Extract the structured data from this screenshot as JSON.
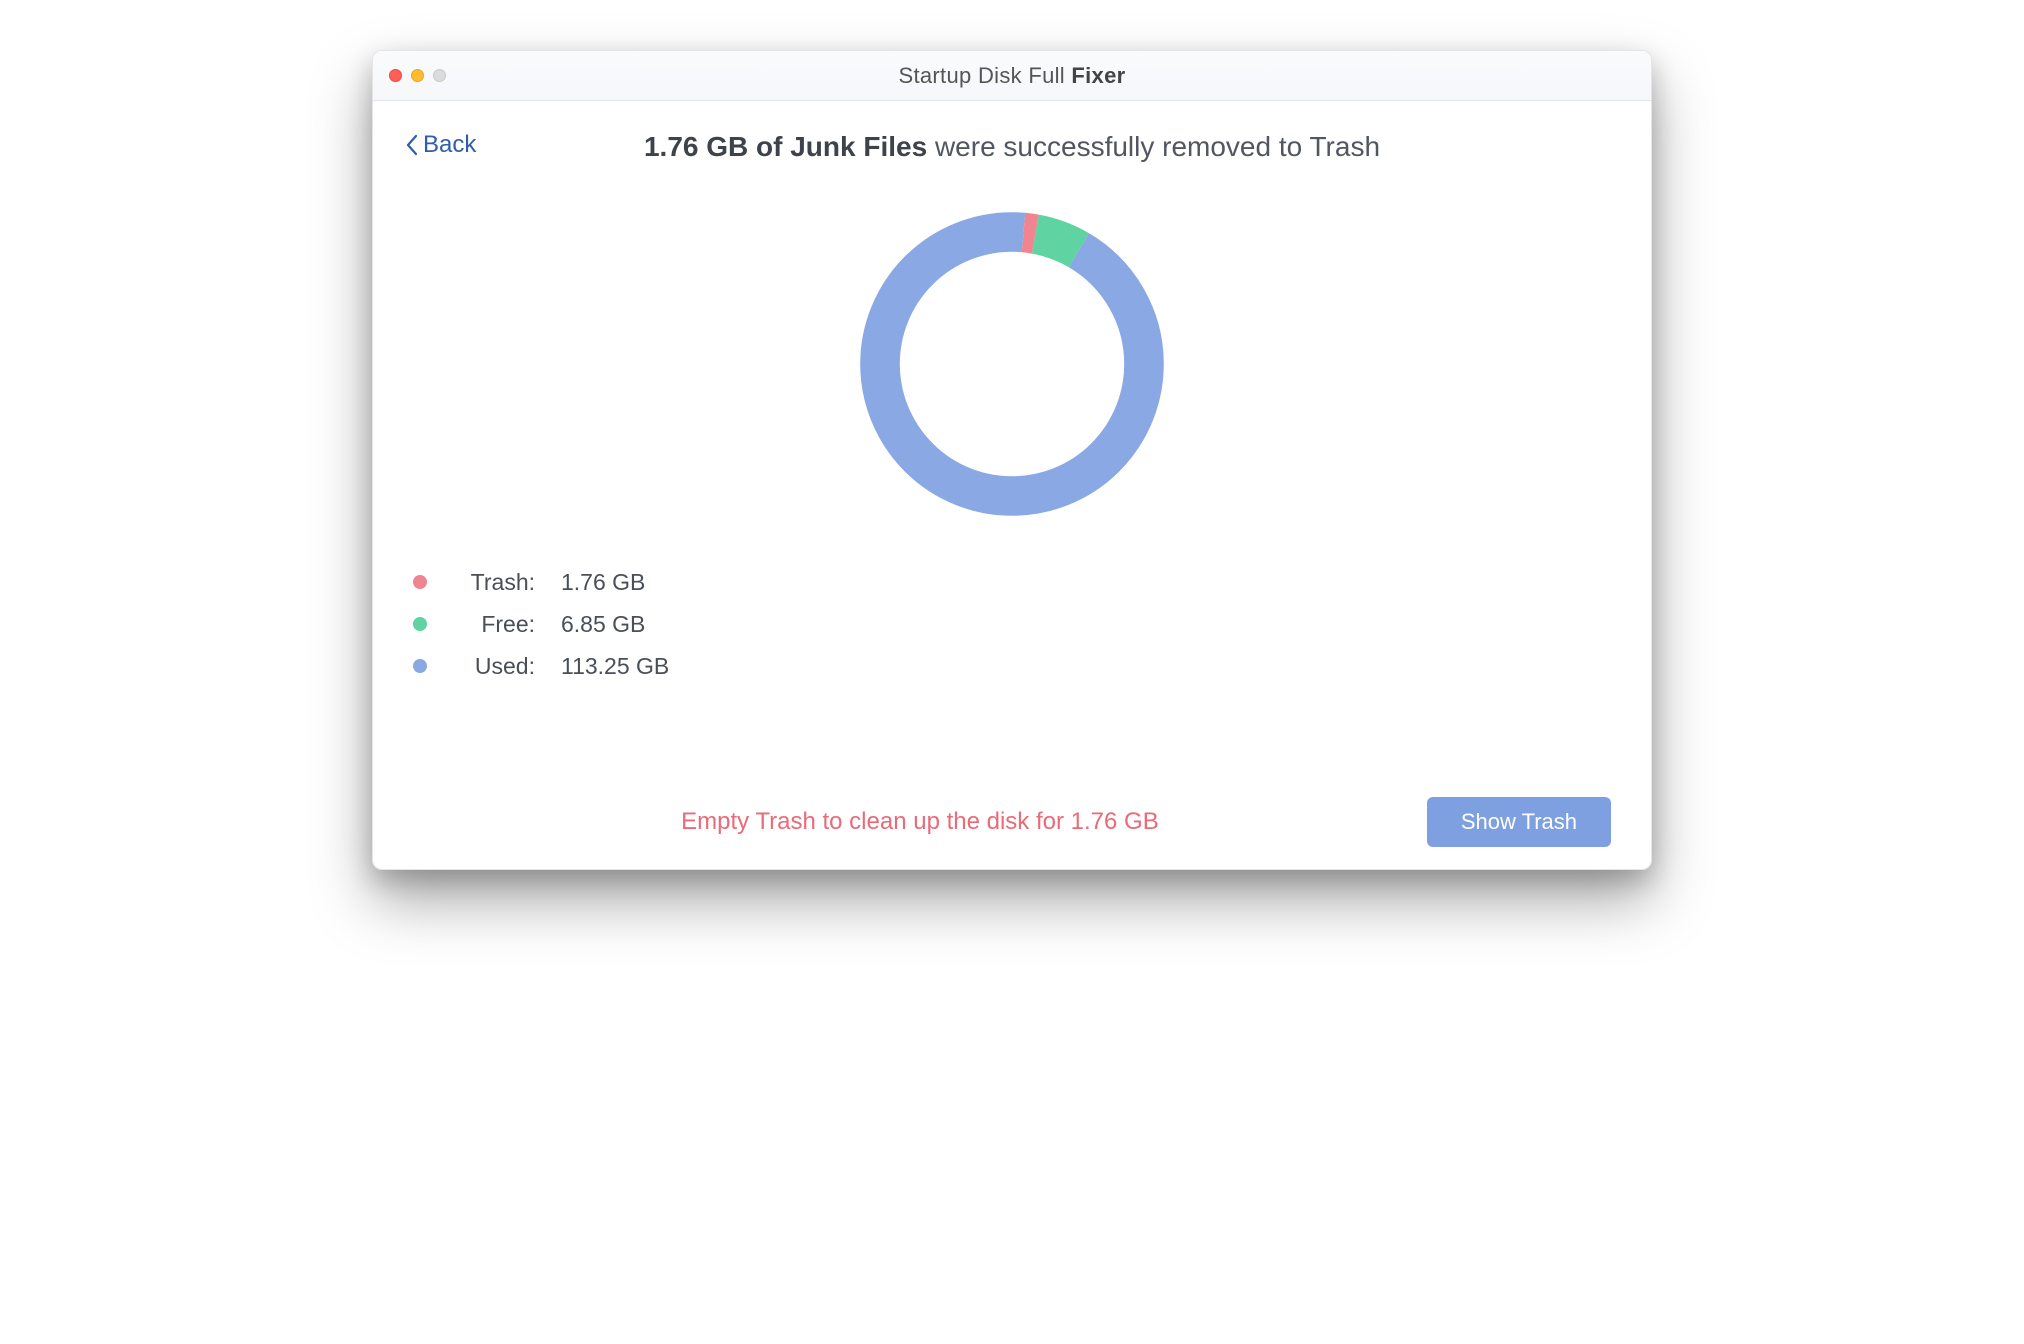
{
  "title": {
    "prefix": "Startup Disk Full ",
    "bold_suffix": "Fixer"
  },
  "back_label": "Back",
  "headline": {
    "bold_prefix": "1.76 GB of Junk Files",
    "suffix": " were successfully removed to Trash"
  },
  "legend": [
    {
      "label": "Trash:",
      "value": "1.76 GB",
      "color": "#f08591"
    },
    {
      "label": "Free:",
      "value": "6.85 GB",
      "color": "#5fd3a2"
    },
    {
      "label": "Used:",
      "value": "113.25 GB",
      "color": "#8aa8e3"
    }
  ],
  "tip": "Empty Trash to clean up the disk for 1.76 GB",
  "show_trash_label": "Show Trash",
  "colors": {
    "trash": "#f08591",
    "free": "#5fd3a2",
    "used": "#8aa8e3",
    "accent_text": "#ea6a78",
    "button": "#7ea0e0"
  },
  "chart_data": {
    "type": "pie",
    "title": "Startup disk usage",
    "series": [
      {
        "name": "Trash",
        "value": 1.76,
        "color": "#f08591"
      },
      {
        "name": "Free",
        "value": 6.85,
        "color": "#5fd3a2"
      },
      {
        "name": "Used",
        "value": 113.25,
        "color": "#8aa8e3"
      }
    ],
    "unit": "GB",
    "donut": true,
    "start_angle_deg": -5,
    "legend_position": "bottom"
  }
}
